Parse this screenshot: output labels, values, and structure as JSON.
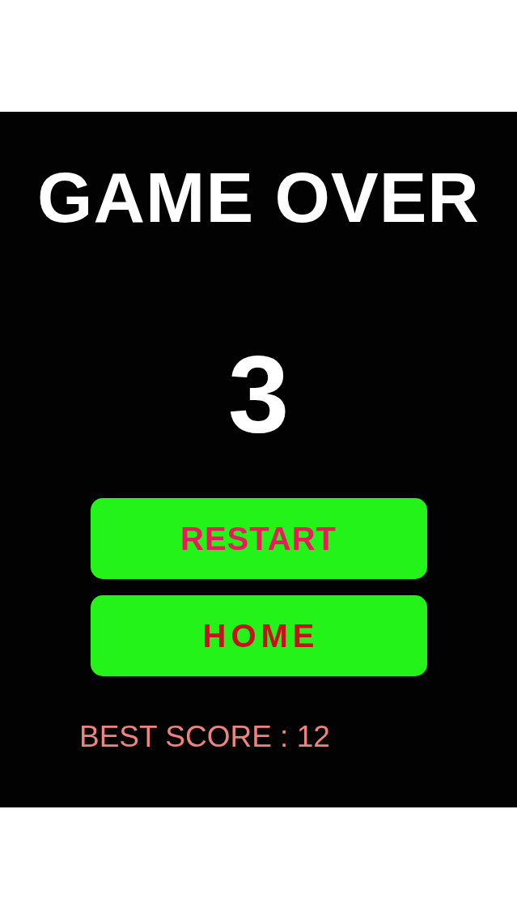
{
  "title": "GAME OVER",
  "score": "3",
  "buttons": [
    {
      "label": "RESTART",
      "kind": "restart"
    },
    {
      "label": "HOME",
      "kind": "home"
    }
  ],
  "best_score": "BEST SCORE : 12"
}
